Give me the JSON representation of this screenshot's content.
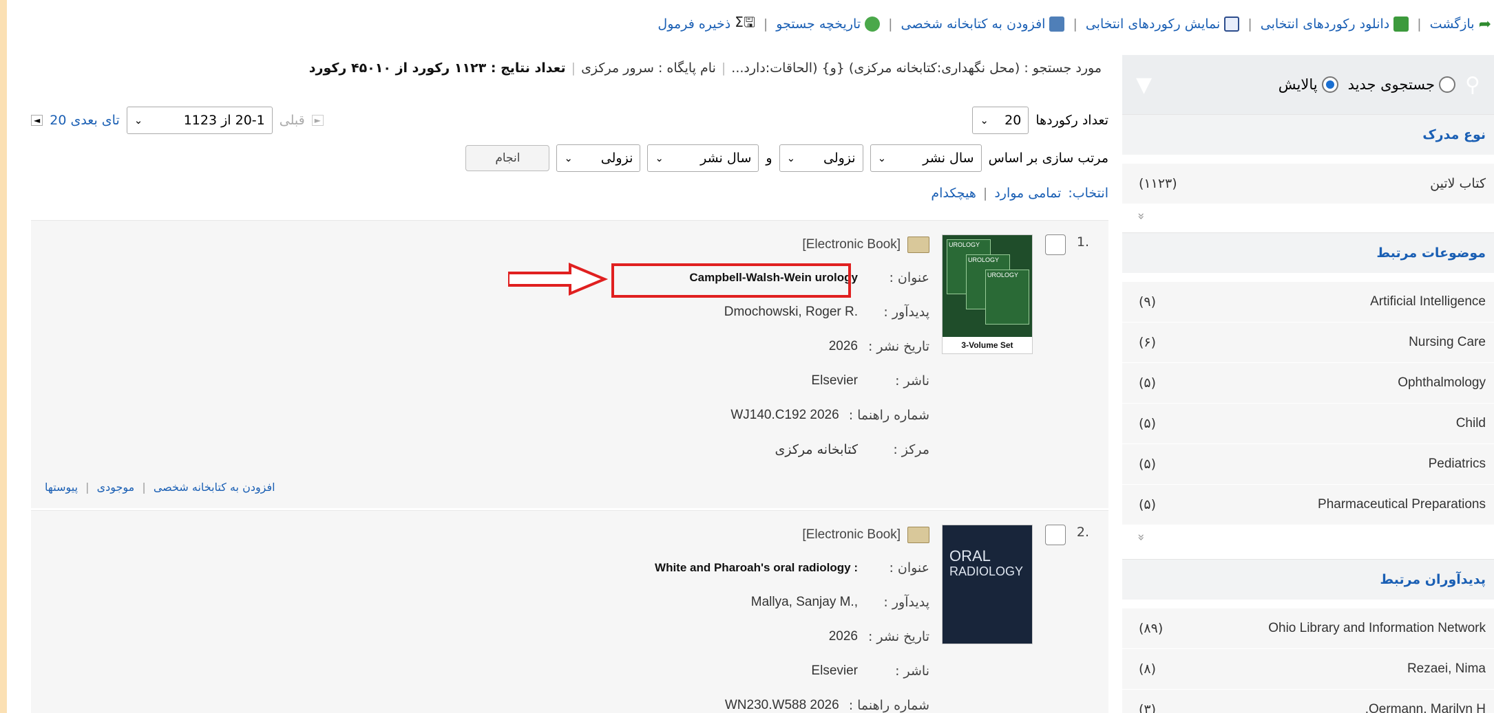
{
  "toolbar": {
    "back": "بازگشت",
    "download": "دانلود رکوردهای انتخابی",
    "show": "نمایش رکوردهای انتخابی",
    "add_library": "افزودن به کتابخانه شخصی",
    "history": "تاریخچه جستجو",
    "save": "ذخیره فرمول"
  },
  "query": {
    "case": "مورد جستجو : (محل نگهداری:کتابخانه مرکزی) {و} (الحاقات:دارد...",
    "db": "نام پایگاه : سرور مرکزی",
    "count_label": "تعداد نتایج : ۱۱۲۳ رکورد از ۴۵۰۱۰ رکورد"
  },
  "sidebar": {
    "new_search": "جستجوی جدید",
    "refine": "پالایش",
    "doc_type": {
      "title": "نوع مدرک",
      "items": [
        {
          "label": "کتاب لاتین",
          "count": "(۱۱۲۳)"
        }
      ]
    },
    "subjects": {
      "title": "موضوعات مرتبط",
      "items": [
        {
          "label": "Artificial Intelligence",
          "count": "(۹)"
        },
        {
          "label": "Nursing Care",
          "count": "(۶)"
        },
        {
          "label": "Ophthalmology",
          "count": "(۵)"
        },
        {
          "label": "Child",
          "count": "(۵)"
        },
        {
          "label": "Pediatrics",
          "count": "(۵)"
        },
        {
          "label": "Pharmaceutical Preparations",
          "count": "(۵)"
        }
      ]
    },
    "authors": {
      "title": "پدیدآوران مرتبط",
      "items": [
        {
          "label": "Ohio Library and Information Network",
          "count": "(۸۹)"
        },
        {
          "label": "Rezaei, Nima",
          "count": "(۸)"
        },
        {
          "label": "Oermann, Marilyn H.",
          "count": "(۳)"
        }
      ]
    },
    "more_glyph": "»"
  },
  "controls": {
    "records_label": "تعداد رکوردها",
    "records_value": "20",
    "pager_prev": "قبلی",
    "pager_range": "20-1 از 1123",
    "pager_next": "20 تای بعدی",
    "sort_label": "مرتب سازی بر اساس",
    "sort1": "سال نشر",
    "order1": "نزولی",
    "and": "و",
    "sort2": "سال نشر",
    "order2": "نزولی",
    "go": "انجام",
    "select_label": "انتخاب:",
    "select_all": "تمامی موارد",
    "select_none": "هیچکدام"
  },
  "labels": {
    "title": "عنوان :",
    "author": "پدیدآور :",
    "date": "تاریخ نشر :",
    "publisher": "ناشر :",
    "callno_prefix": "شماره راهنما :",
    "center": "مرکز :"
  },
  "results": [
    {
      "num": "1.",
      "type": "[Electronic Book]",
      "title": "Campbell-Walsh-Wein urology",
      "author": "Dmochowski, Roger R.",
      "date": "2026",
      "publisher": "Elsevier",
      "callno": "WJ140.C192 2026",
      "center": "کتابخانه مرکزی",
      "cover_text": [
        "UROLOGY",
        "UROLOGY",
        "UROLOGY",
        "3-Volume Set"
      ],
      "links": [
        "افزودن به کتابخانه شخصی",
        "موجودی",
        "پیوستها"
      ]
    },
    {
      "num": "2.",
      "type": "[Electronic Book]",
      "title": "White and Pharoah's oral radiology :",
      "author": "Mallya, Sanjay M.,",
      "date": "2026",
      "publisher": "Elsevier",
      "callno": "WN230.W588 2026",
      "cover_text": [
        "ORAL",
        "RADIOLOGY"
      ]
    }
  ],
  "colors": {
    "link": "#1a5fb4",
    "highlight": "#e02020",
    "border": "#fbe0b3"
  }
}
